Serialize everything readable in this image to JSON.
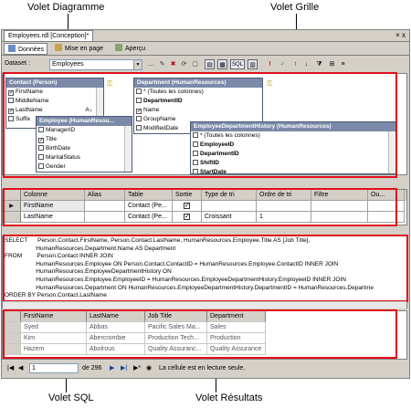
{
  "callouts": {
    "diagram": "Volet Diagramme",
    "grid": "Volet Grille",
    "sql": "Volet SQL",
    "results": "Volet Résultats"
  },
  "window": {
    "doc_tab": "Employees.rdl [Conception]*",
    "close": "× x"
  },
  "tabs": [
    {
      "label": "Données"
    },
    {
      "label": "Mise en page"
    },
    {
      "label": "Aperçu"
    }
  ],
  "toolbar": {
    "dataset_label": "Dataset :",
    "dataset_value": "Employees",
    "sql_button": "SQL",
    "icons": [
      "cut-icon",
      "delete-icon",
      "run-icon",
      "table-icon",
      "diagram-pane-icon",
      "grid-pane-icon",
      "sql-pane-icon",
      "results-pane-icon",
      "error-icon",
      "verify-icon",
      "filter-icon",
      "sort-asc-icon",
      "sort-desc-icon",
      "group-icon",
      "properties-icon"
    ]
  },
  "diagram": {
    "tables": [
      {
        "title": "Contact (Person)",
        "rows": [
          {
            "checked": true,
            "label": "FirstName",
            "bold": false
          },
          {
            "checked": false,
            "label": "MiddleName",
            "bold": false
          },
          {
            "checked": true,
            "label": "LastName",
            "bold": false
          },
          {
            "checked": false,
            "label": "Suffix",
            "bold": false
          }
        ]
      },
      {
        "title": "Department (HumanResources)",
        "rows": [
          {
            "checked": false,
            "label": "* (Toutes les colonnes)",
            "bold": false
          },
          {
            "checked": false,
            "label": "DepartmentID",
            "bold": true
          },
          {
            "checked": true,
            "label": "Name",
            "bold": false
          },
          {
            "checked": false,
            "label": "GroupName",
            "bold": false
          },
          {
            "checked": false,
            "label": "ModifiedDate",
            "bold": false
          }
        ]
      },
      {
        "title": "Employee (HumanResou...",
        "rows": [
          {
            "checked": false,
            "label": "ManagerID",
            "bold": false
          },
          {
            "checked": true,
            "label": "Title",
            "bold": false
          },
          {
            "checked": false,
            "label": "BirthDate",
            "bold": false
          },
          {
            "checked": false,
            "label": "MaritalStatus",
            "bold": false
          },
          {
            "checked": false,
            "label": "Gender",
            "bold": false
          }
        ]
      },
      {
        "title": "EmployeeDepartmentHistory (HumanResources)",
        "rows": [
          {
            "checked": false,
            "label": "* (Toutes les colonnes)",
            "bold": false
          },
          {
            "checked": false,
            "label": "EmployeeID",
            "bold": true
          },
          {
            "checked": false,
            "label": "DepartmentID",
            "bold": true
          },
          {
            "checked": false,
            "label": "ShiftID",
            "bold": true
          },
          {
            "checked": false,
            "label": "StartDate",
            "bold": true
          }
        ]
      }
    ],
    "sort_glyph": "A↓"
  },
  "grid": {
    "headers": [
      "Colonne",
      "Alias",
      "Table",
      "Sortie",
      "Type de tri",
      "Ordre de tri",
      "Filtre",
      "Ou..."
    ],
    "rows": [
      {
        "marker": "▶",
        "colonne": "FirstName",
        "alias": "",
        "table": "Contact (Pe...",
        "sortie": "✓",
        "type_tri": "",
        "ordre_tri": ""
      },
      {
        "marker": "",
        "colonne": "LastName",
        "alias": "",
        "table": "Contact (Pe...",
        "sortie": "✓",
        "type_tri": "Croissant",
        "ordre_tri": "1"
      }
    ]
  },
  "sql": {
    "lines": [
      "SELECT      Person.Contact.FirstName, Person.Contact.LastName, HumanResources.Employee.Title AS [Job Title],",
      "                   HumanResources.Department.Name AS Department",
      "FROM         Person.Contact INNER JOIN",
      "                   HumanResources.Employee ON Person.Contact.ContactID = HumanResources.Employee.ContactID INNER JOIN",
      "                   HumanResources.EmployeeDepartmentHistory ON",
      "                   HumanResources.Employee.EmployeeID = HumanResources.EmployeeDepartmentHistory.EmployeeID INNER JOIN",
      "                   HumanResources.Department ON HumanResources.EmployeeDepartmentHistory.DepartmentID = HumanResources.Departme",
      "ORDER BY Person.Contact.LastName"
    ]
  },
  "results": {
    "headers": [
      "FirstName",
      "LastName",
      "Job Title",
      "Department"
    ],
    "rows": [
      [
        "Syed",
        "Abbas",
        "Pacific Sales Ma...",
        "Sales"
      ],
      [
        "Kim",
        "Abercrombie",
        "Production Tech...",
        "Production"
      ],
      [
        "Hazem",
        "Abolrous",
        "Quality Assuranc...",
        "Quality Assurance"
      ]
    ]
  },
  "nav": {
    "current": "1",
    "of_label": "de 296",
    "status": "La cellule est en lecture seule."
  }
}
